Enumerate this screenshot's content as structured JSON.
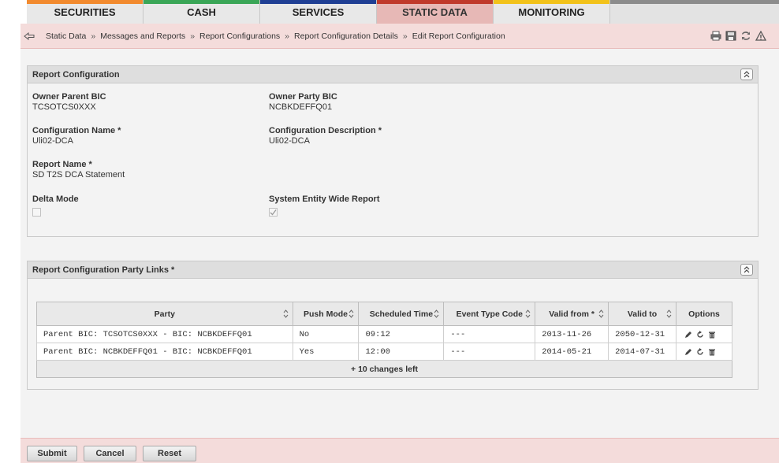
{
  "nav": {
    "tabs": [
      {
        "label": "SECURITIES",
        "color": "#f28a2e"
      },
      {
        "label": "CASH",
        "color": "#3aa657"
      },
      {
        "label": "SERVICES",
        "color": "#1f3f94"
      },
      {
        "label": "STATIC DATA",
        "color": "#c0392b"
      },
      {
        "label": "MONITORING",
        "color": "#f2c21a"
      }
    ],
    "active_tab": "STATIC DATA"
  },
  "breadcrumb": {
    "back_icon": "back-arrow-icon",
    "items": [
      "Static Data",
      "Messages and Reports",
      "Report Configurations",
      "Report Configuration Details",
      "Edit Report Configuration"
    ],
    "separator": "»",
    "tools": [
      "print-icon",
      "save-icon",
      "refresh-icon",
      "alert-icon"
    ]
  },
  "report_config": {
    "title": "Report Configuration",
    "owner_parent_bic": {
      "label": "Owner Parent BIC",
      "value": "TCSOTCS0XXX"
    },
    "owner_party_bic": {
      "label": "Owner Party BIC",
      "value": "NCBKDEFFQ01"
    },
    "configuration_name": {
      "label": "Configuration Name *",
      "value": "Uli02-DCA"
    },
    "configuration_description": {
      "label": "Configuration Description *",
      "value": "Uli02-DCA"
    },
    "report_name": {
      "label": "Report Name *",
      "value": "SD T2S DCA Statement"
    },
    "delta_mode": {
      "label": "Delta Mode",
      "checked": false
    },
    "system_entity_wide": {
      "label": "System Entity Wide Report",
      "checked": true
    }
  },
  "party_links": {
    "title": "Report Configuration Party Links *",
    "columns": [
      "Party",
      "Push Mode",
      "Scheduled Time",
      "Event Type Code",
      "Valid from *",
      "Valid to",
      "Options"
    ],
    "rows": [
      {
        "party": "Parent BIC: TCSOTCS0XXX - BIC: NCBKDEFFQ01",
        "push_mode": "No",
        "scheduled_time": "09:12",
        "event_type_code": "---",
        "valid_from": "2013-11-26",
        "valid_to": "2050-12-31"
      },
      {
        "party": "Parent BIC: NCBKDEFFQ01 - BIC: NCBKDEFFQ01",
        "push_mode": "Yes",
        "scheduled_time": "12:00",
        "event_type_code": "---",
        "valid_from": "2014-05-21",
        "valid_to": "2014-07-31"
      }
    ],
    "add_label": "+ 10 changes left"
  },
  "footer": {
    "submit": "Submit",
    "cancel": "Cancel",
    "reset": "Reset"
  }
}
